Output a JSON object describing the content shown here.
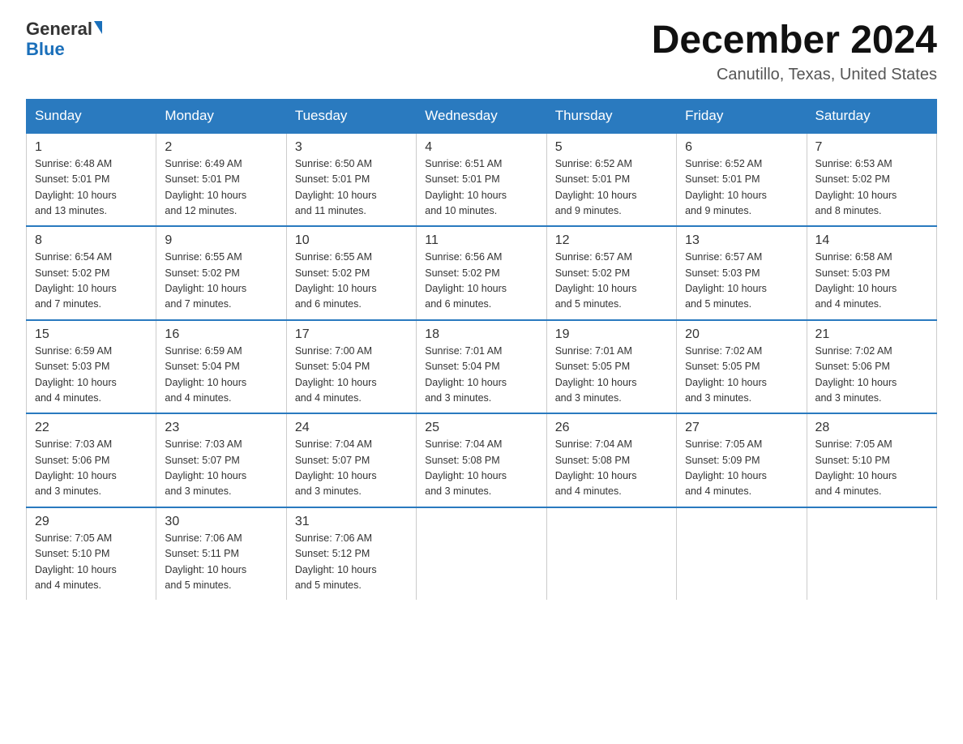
{
  "logo": {
    "general": "General",
    "triangle": "▶",
    "blue": "Blue"
  },
  "title": "December 2024",
  "subtitle": "Canutillo, Texas, United States",
  "days_of_week": [
    "Sunday",
    "Monday",
    "Tuesday",
    "Wednesday",
    "Thursday",
    "Friday",
    "Saturday"
  ],
  "weeks": [
    [
      {
        "day": "1",
        "sunrise": "6:48 AM",
        "sunset": "5:01 PM",
        "daylight": "10 hours and 13 minutes."
      },
      {
        "day": "2",
        "sunrise": "6:49 AM",
        "sunset": "5:01 PM",
        "daylight": "10 hours and 12 minutes."
      },
      {
        "day": "3",
        "sunrise": "6:50 AM",
        "sunset": "5:01 PM",
        "daylight": "10 hours and 11 minutes."
      },
      {
        "day": "4",
        "sunrise": "6:51 AM",
        "sunset": "5:01 PM",
        "daylight": "10 hours and 10 minutes."
      },
      {
        "day": "5",
        "sunrise": "6:52 AM",
        "sunset": "5:01 PM",
        "daylight": "10 hours and 9 minutes."
      },
      {
        "day": "6",
        "sunrise": "6:52 AM",
        "sunset": "5:01 PM",
        "daylight": "10 hours and 9 minutes."
      },
      {
        "day": "7",
        "sunrise": "6:53 AM",
        "sunset": "5:02 PM",
        "daylight": "10 hours and 8 minutes."
      }
    ],
    [
      {
        "day": "8",
        "sunrise": "6:54 AM",
        "sunset": "5:02 PM",
        "daylight": "10 hours and 7 minutes."
      },
      {
        "day": "9",
        "sunrise": "6:55 AM",
        "sunset": "5:02 PM",
        "daylight": "10 hours and 7 minutes."
      },
      {
        "day": "10",
        "sunrise": "6:55 AM",
        "sunset": "5:02 PM",
        "daylight": "10 hours and 6 minutes."
      },
      {
        "day": "11",
        "sunrise": "6:56 AM",
        "sunset": "5:02 PM",
        "daylight": "10 hours and 6 minutes."
      },
      {
        "day": "12",
        "sunrise": "6:57 AM",
        "sunset": "5:02 PM",
        "daylight": "10 hours and 5 minutes."
      },
      {
        "day": "13",
        "sunrise": "6:57 AM",
        "sunset": "5:03 PM",
        "daylight": "10 hours and 5 minutes."
      },
      {
        "day": "14",
        "sunrise": "6:58 AM",
        "sunset": "5:03 PM",
        "daylight": "10 hours and 4 minutes."
      }
    ],
    [
      {
        "day": "15",
        "sunrise": "6:59 AM",
        "sunset": "5:03 PM",
        "daylight": "10 hours and 4 minutes."
      },
      {
        "day": "16",
        "sunrise": "6:59 AM",
        "sunset": "5:04 PM",
        "daylight": "10 hours and 4 minutes."
      },
      {
        "day": "17",
        "sunrise": "7:00 AM",
        "sunset": "5:04 PM",
        "daylight": "10 hours and 4 minutes."
      },
      {
        "day": "18",
        "sunrise": "7:01 AM",
        "sunset": "5:04 PM",
        "daylight": "10 hours and 3 minutes."
      },
      {
        "day": "19",
        "sunrise": "7:01 AM",
        "sunset": "5:05 PM",
        "daylight": "10 hours and 3 minutes."
      },
      {
        "day": "20",
        "sunrise": "7:02 AM",
        "sunset": "5:05 PM",
        "daylight": "10 hours and 3 minutes."
      },
      {
        "day": "21",
        "sunrise": "7:02 AM",
        "sunset": "5:06 PM",
        "daylight": "10 hours and 3 minutes."
      }
    ],
    [
      {
        "day": "22",
        "sunrise": "7:03 AM",
        "sunset": "5:06 PM",
        "daylight": "10 hours and 3 minutes."
      },
      {
        "day": "23",
        "sunrise": "7:03 AM",
        "sunset": "5:07 PM",
        "daylight": "10 hours and 3 minutes."
      },
      {
        "day": "24",
        "sunrise": "7:04 AM",
        "sunset": "5:07 PM",
        "daylight": "10 hours and 3 minutes."
      },
      {
        "day": "25",
        "sunrise": "7:04 AM",
        "sunset": "5:08 PM",
        "daylight": "10 hours and 3 minutes."
      },
      {
        "day": "26",
        "sunrise": "7:04 AM",
        "sunset": "5:08 PM",
        "daylight": "10 hours and 4 minutes."
      },
      {
        "day": "27",
        "sunrise": "7:05 AM",
        "sunset": "5:09 PM",
        "daylight": "10 hours and 4 minutes."
      },
      {
        "day": "28",
        "sunrise": "7:05 AM",
        "sunset": "5:10 PM",
        "daylight": "10 hours and 4 minutes."
      }
    ],
    [
      {
        "day": "29",
        "sunrise": "7:05 AM",
        "sunset": "5:10 PM",
        "daylight": "10 hours and 4 minutes."
      },
      {
        "day": "30",
        "sunrise": "7:06 AM",
        "sunset": "5:11 PM",
        "daylight": "10 hours and 5 minutes."
      },
      {
        "day": "31",
        "sunrise": "7:06 AM",
        "sunset": "5:12 PM",
        "daylight": "10 hours and 5 minutes."
      },
      null,
      null,
      null,
      null
    ]
  ],
  "labels": {
    "sunrise": "Sunrise:",
    "sunset": "Sunset:",
    "daylight": "Daylight:"
  }
}
